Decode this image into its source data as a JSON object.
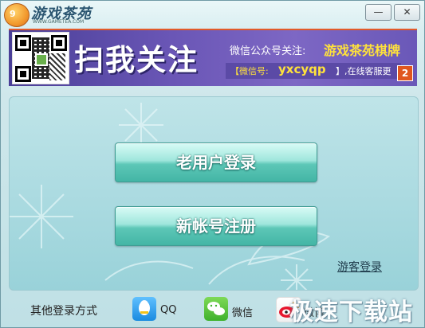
{
  "titlebar": {
    "logo_badge": "9",
    "logo_text": "游戏茶苑",
    "logo_sub": "WWW.GAMETEA.COM",
    "minimize": "—",
    "close": "✕"
  },
  "banner": {
    "headline": "扫我关注",
    "follow_text": "微信公众号关注:",
    "account_name": "游戏茶苑棋牌",
    "wx_label": "【微信号:",
    "wx_id": "yxcyqp",
    "service_text": "】,在线客服更",
    "page_number": "2"
  },
  "main": {
    "old_user_login": "老用户登录",
    "new_account_register": "新帐号注册",
    "guest_login": "游客登录"
  },
  "footer": {
    "other_login_label": "其他登录方式",
    "qq": "QQ",
    "wechat": "微信",
    "weibo": "微博"
  },
  "watermark": "极速下载站"
}
